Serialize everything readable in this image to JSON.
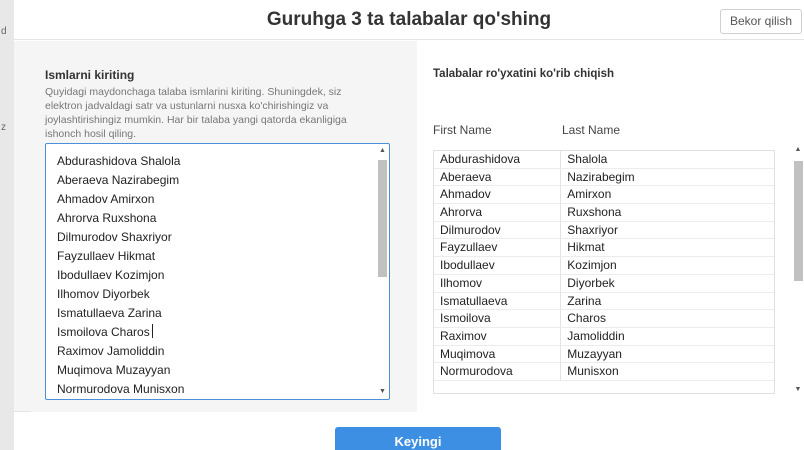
{
  "backdrop": {
    "fragment_top": "d",
    "fragment_mid": "z"
  },
  "modal": {
    "title": "Guruhga 3 ta talabalar qo'shing",
    "cancel_label": "Bekor qilish",
    "next_label": "Keyingi"
  },
  "left": {
    "title": "Ismlarni kiriting",
    "description": "Quyidagi maydonchaga talaba ismlarini kiriting. Shuningdek, siz elektron jadvaldagi satr va ustunlarni nusxa ko'chirishingiz va joylashtirishingiz mumkin. Har bir talaba yangi qatorda ekanligiga ishonch hosil qiling.",
    "lines": [
      "Abdurashidova Shalola",
      "Aberaeva Nazirabegim",
      "Ahmadov Amirxon",
      "Ahrorva Ruxshona",
      "Dilmurodov Shaxriyor",
      "Fayzullaev Hikmat",
      "Ibodullaev Kozimjon",
      "Ilhomov Diyorbek",
      "Ismatullaeva Zarina",
      "Ismoilova Charos",
      "Raximov Jamoliddin",
      "Muqimova Muzayyan",
      "Normurodova Munisxon"
    ]
  },
  "right": {
    "title": "Talabalar ro'yxatini ko'rib chiqish",
    "columns": [
      "First Name",
      "Last Name"
    ],
    "rows": [
      [
        "Abdurashidova",
        "Shalola"
      ],
      [
        "Aberaeva",
        "Nazirabegim"
      ],
      [
        "Ahmadov",
        "Amirxon"
      ],
      [
        "Ahrorva",
        "Ruxshona"
      ],
      [
        "Dilmurodov",
        "Shaxriyor"
      ],
      [
        "Fayzullaev",
        "Hikmat"
      ],
      [
        "Ibodullaev",
        "Kozimjon"
      ],
      [
        "Ilhomov",
        "Diyorbek"
      ],
      [
        "Ismatullaeva",
        "Zarina"
      ],
      [
        "Ismoilova",
        "Charos"
      ],
      [
        "Raximov",
        "Jamoliddin"
      ],
      [
        "Muqimova",
        "Muzayyan"
      ],
      [
        "Normurodova",
        "Munisxon"
      ]
    ]
  },
  "colors": {
    "accent": "#3d8fe3",
    "focus_border": "#4a90d9"
  },
  "icons": {
    "scroll_up": "▲",
    "scroll_down": "▼"
  }
}
